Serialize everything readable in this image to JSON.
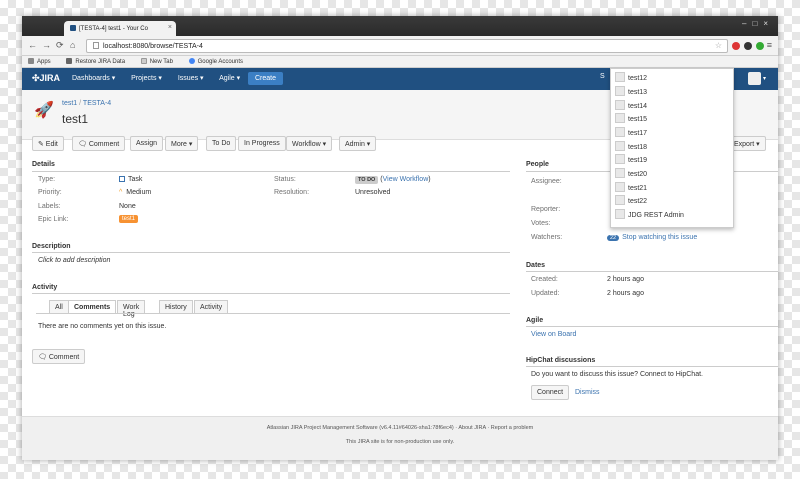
{
  "browser": {
    "tab_title": "[TESTA-4] test1 - Your Co",
    "url": "localhost:8080/browse/TESTA-4",
    "bookmarks": [
      "Apps",
      "Restore JIRA Data",
      "New Tab",
      "Google Accounts"
    ]
  },
  "header": {
    "logo": "JIRA",
    "nav": [
      "Dashboards ▾",
      "Projects ▾",
      "Issues ▾",
      "Agile ▾"
    ],
    "create": "Create",
    "search_prefix": "S"
  },
  "issue": {
    "project": "test1",
    "separator": "/",
    "key": "TESTA-4",
    "title": "test1"
  },
  "actions": {
    "edit": "✎ Edit",
    "comment": "Comment",
    "assign": "Assign",
    "more": "More ▾",
    "todo": "To Do",
    "in_progress": "In Progress",
    "workflow": "Workflow ▾",
    "admin": "Admin ▾",
    "export": "Export ▾"
  },
  "details": {
    "heading": "Details",
    "type_label": "Type:",
    "type_value": "Task",
    "priority_label": "Priority:",
    "priority_value": "Medium",
    "labels_label": "Labels:",
    "labels_value": "None",
    "epic_label": "Epic Link:",
    "epic_value": "test1",
    "status_label": "Status:",
    "status_value": "TO DO",
    "view_workflow": "View Workflow",
    "resolution_label": "Resolution:",
    "resolution_value": "Unresolved"
  },
  "description": {
    "heading": "Description",
    "placeholder": "Click to add description"
  },
  "activity": {
    "heading": "Activity",
    "tabs": [
      "All",
      "Comments",
      "Work Log",
      "History",
      "Activity"
    ],
    "empty": "There are no comments yet on this issue.",
    "comment_button": "Comment"
  },
  "people": {
    "heading": "People",
    "assignee_label": "Assignee:",
    "reporter_label": "Reporter:",
    "votes_label": "Votes:",
    "watchers_label": "Watchers:",
    "watchers_count": "22",
    "stop_watching": "Stop watching this issue"
  },
  "dates": {
    "heading": "Dates",
    "created_label": "Created:",
    "created_value": "2 hours ago",
    "updated_label": "Updated:",
    "updated_value": "2 hours ago"
  },
  "agile": {
    "heading": "Agile",
    "link": "View on Board"
  },
  "hipchat": {
    "heading": "HipChat discussions",
    "text": "Do you want to discuss this issue? Connect to HipChat.",
    "connect": "Connect",
    "dismiss": "Dismiss"
  },
  "footer": {
    "line1": "Atlassian JIRA Project Management Software (v6.4.11#64026-sha1:78f6ec4)  ·  About JIRA  ·  Report a problem",
    "line2": "This JIRA site is for non-production use only."
  },
  "user_dropdown": [
    "test12",
    "test13",
    "test14",
    "test15",
    "test17",
    "test18",
    "test19",
    "test20",
    "test21",
    "test22",
    "JDG REST Admin"
  ],
  "colors": {
    "header": "#205081",
    "link": "#3b73af",
    "epic": "#f79232"
  }
}
